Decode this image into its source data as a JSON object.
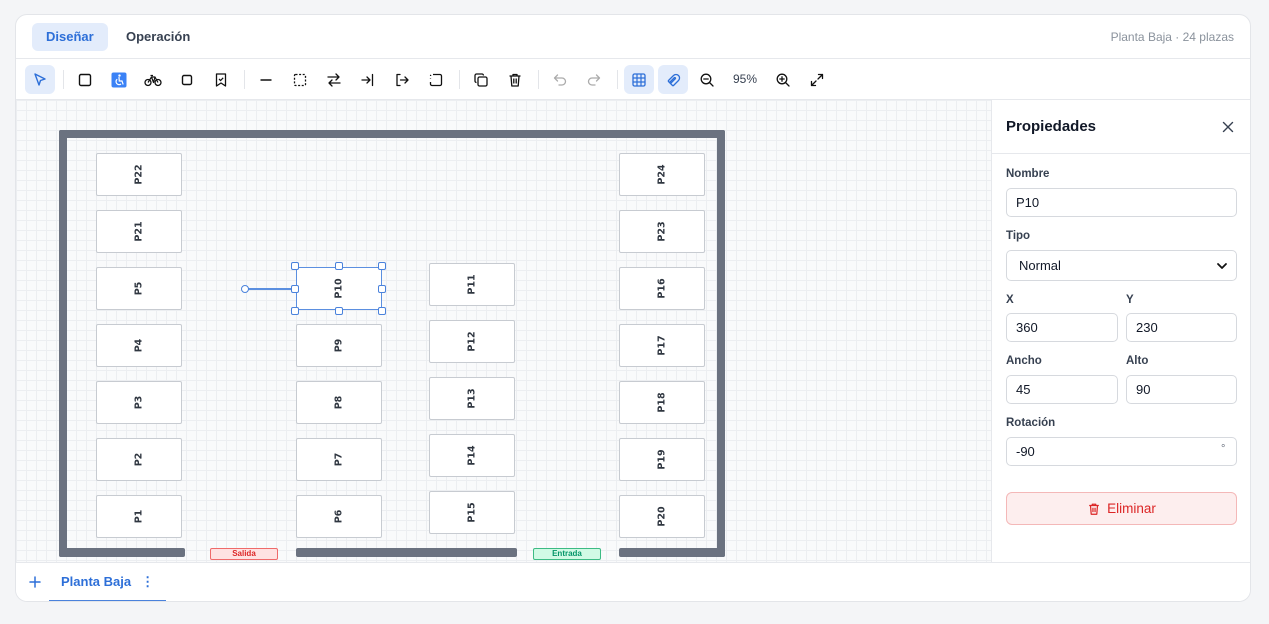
{
  "header": {
    "tabs": [
      {
        "label": "Diseñar",
        "active": true
      },
      {
        "label": "Operación",
        "active": false
      }
    ],
    "meta": "Planta Baja · 24 plazas"
  },
  "toolbar": {
    "zoom": "95%",
    "tools": [
      "select",
      "spot-normal",
      "spot-accessible",
      "spot-bicycle",
      "spot-small",
      "spot-reserved",
      "wall",
      "area",
      "direction",
      "entry",
      "exit",
      "zone",
      "duplicate",
      "delete",
      "undo",
      "redo",
      "grid",
      "snap",
      "zoom-out",
      "zoom-in",
      "fit"
    ]
  },
  "canvas": {
    "spots": [
      {
        "label": "P22",
        "selected": false
      },
      {
        "label": "P21",
        "selected": false
      },
      {
        "label": "P5",
        "selected": false
      },
      {
        "label": "P4",
        "selected": false
      },
      {
        "label": "P3",
        "selected": false
      },
      {
        "label": "P2",
        "selected": false
      },
      {
        "label": "P1",
        "selected": false
      },
      {
        "label": "P10",
        "selected": true
      },
      {
        "label": "P9",
        "selected": false
      },
      {
        "label": "P8",
        "selected": false
      },
      {
        "label": "P7",
        "selected": false
      },
      {
        "label": "P6",
        "selected": false
      },
      {
        "label": "P11",
        "selected": false
      },
      {
        "label": "P12",
        "selected": false
      },
      {
        "label": "P13",
        "selected": false
      },
      {
        "label": "P14",
        "selected": false
      },
      {
        "label": "P15",
        "selected": false
      },
      {
        "label": "P24",
        "selected": false
      },
      {
        "label": "P23",
        "selected": false
      },
      {
        "label": "P16",
        "selected": false
      },
      {
        "label": "P17",
        "selected": false
      },
      {
        "label": "P18",
        "selected": false
      },
      {
        "label": "P19",
        "selected": false
      },
      {
        "label": "P20",
        "selected": false
      }
    ],
    "doors": {
      "exit": "Salida",
      "entry": "Entrada"
    }
  },
  "panel": {
    "title": "Propiedades",
    "fields": {
      "nombre_label": "Nombre",
      "nombre_value": "P10",
      "tipo_label": "Tipo",
      "tipo_value": "Normal",
      "x_label": "X",
      "x_value": "360",
      "y_label": "Y",
      "y_value": "230",
      "ancho_label": "Ancho",
      "ancho_value": "45",
      "alto_label": "Alto",
      "alto_value": "90",
      "rotacion_label": "Rotación",
      "rotacion_value": "-90",
      "rotacion_unit": "°"
    },
    "delete_label": "Eliminar"
  },
  "footer": {
    "floors": [
      {
        "label": "Planta Baja",
        "active": true
      }
    ]
  },
  "colors": {
    "accent": "#2d6fd8",
    "accent_bg": "#e3ecfb",
    "wall": "#6b7280",
    "danger": "#dc2626",
    "success": "#059669"
  }
}
